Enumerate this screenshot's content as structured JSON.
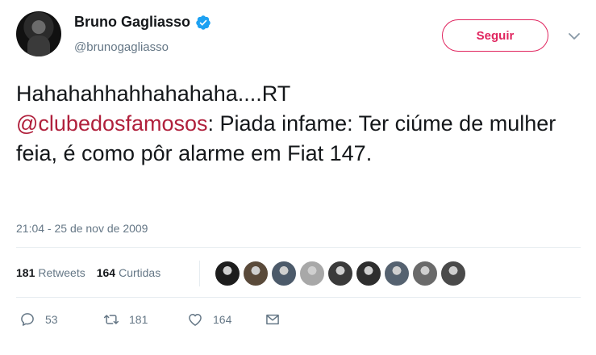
{
  "user": {
    "display_name": "Bruno Gagliasso",
    "handle": "@brunogagliasso",
    "verified": true
  },
  "follow_button": {
    "label": "Seguir",
    "color": "#e0245e"
  },
  "tweet": {
    "line1": "Hahahahhahhahahaha....RT",
    "mention": "@clubedosfamosos",
    "rest": ": Piada infame: Ter ciúme de mulher feia, é como pôr alarme em Fiat 147.",
    "timestamp": "21:04 - 25 de nov de 2009"
  },
  "stats": {
    "retweets_count": "181",
    "retweets_label": "Retweets",
    "likes_count": "164",
    "likes_label": "Curtidas"
  },
  "likers": [
    "#1d1d1d",
    "#5a4a3a",
    "#4c5a6a",
    "#a8a8a8",
    "#3a3a3a",
    "#2e2e2e",
    "#556270",
    "#6a6a6a",
    "#4a4a4a"
  ],
  "actions": {
    "reply_count": "53",
    "retweet_count": "181",
    "like_count": "164"
  },
  "icons": {
    "verified": "verified-badge-icon",
    "caret": "chevron-down-icon",
    "reply": "reply-icon",
    "retweet": "retweet-icon",
    "like": "heart-icon",
    "dm": "envelope-icon"
  }
}
